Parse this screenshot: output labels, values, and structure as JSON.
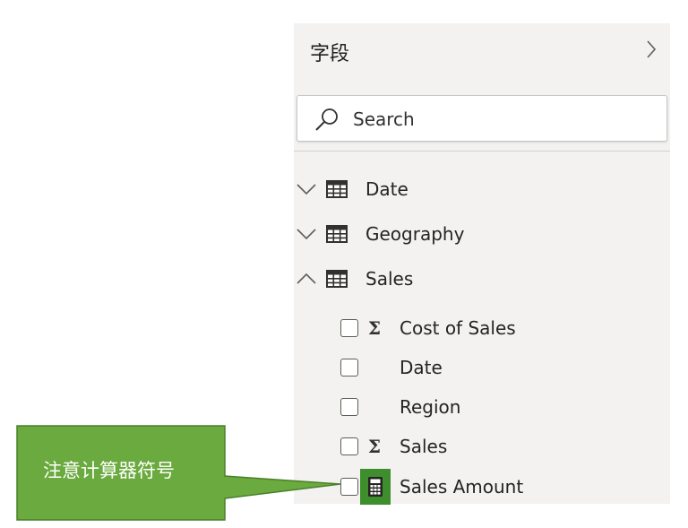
{
  "pane": {
    "title": "字段",
    "collapse_icon": "chevron-right-icon",
    "search": {
      "placeholder": "Search",
      "value": ""
    }
  },
  "tables": [
    {
      "name": "Date",
      "expanded": false,
      "chevron_icon": "chevron-down-icon",
      "icon": "table-icon"
    },
    {
      "name": "Geography",
      "expanded": false,
      "chevron_icon": "chevron-down-icon",
      "icon": "table-icon"
    },
    {
      "name": "Sales",
      "expanded": true,
      "chevron_icon": "chevron-up-icon",
      "icon": "table-icon"
    }
  ],
  "sales_fields": [
    {
      "name": "Cost of Sales",
      "checked": false,
      "type_icon": "sigma-icon",
      "type_symbol": "Σ"
    },
    {
      "name": "Date",
      "checked": false,
      "type_icon": ""
    },
    {
      "name": "Region",
      "checked": false,
      "type_icon": ""
    },
    {
      "name": "Sales",
      "checked": false,
      "type_icon": "sigma-icon",
      "type_symbol": "Σ"
    },
    {
      "name": "Sales Amount",
      "checked": false,
      "type_icon": "calculator-icon",
      "highlighted": true
    }
  ],
  "annotation": {
    "text": "注意计算器符号",
    "fill": "#6aaa3e",
    "border": "#4b7f2b",
    "highlight_color": "#3e8e2e"
  },
  "colors": {
    "pane_background": "#f3f2f1",
    "text": "#252423",
    "separator": "#d2d0ce"
  }
}
